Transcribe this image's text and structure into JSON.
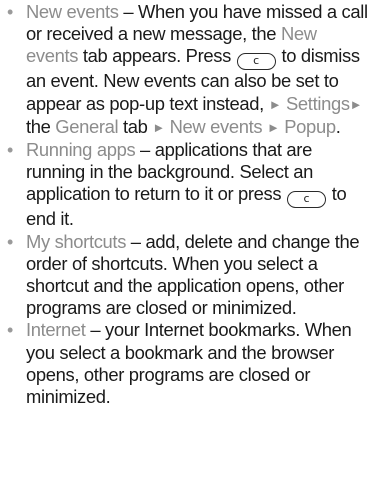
{
  "items": [
    {
      "term": "New events",
      "t1": " – When you have missed a call or received a new message, the ",
      "tab": "New events",
      "t2": " tab appears. Press ",
      "key": "c",
      "t3": " to dismiss an event. New events can also be set to appear as pop-up text instead, ",
      "arrow": "►",
      "path1": "Settings",
      "t4": " the ",
      "path2": "General",
      "t5": " tab ",
      "path3": "New events",
      "path4": "Popup",
      "t6": "."
    },
    {
      "term": "Running apps",
      "t1": " – applications that are running in the background. Select an application to return to it or press ",
      "key": "c",
      "t2": " to end it."
    },
    {
      "term": "My shortcuts",
      "t1": " – add, delete and change the order of shortcuts. When you select a shortcut and the application opens, other programs are closed or minimized."
    },
    {
      "term": "Internet",
      "t1": " – your Internet bookmarks. When you select a bookmark and the browser opens, other programs are closed or minimized."
    }
  ],
  "colors": {
    "highlight": "#8c8c8c",
    "text": "#1a1a1a"
  }
}
